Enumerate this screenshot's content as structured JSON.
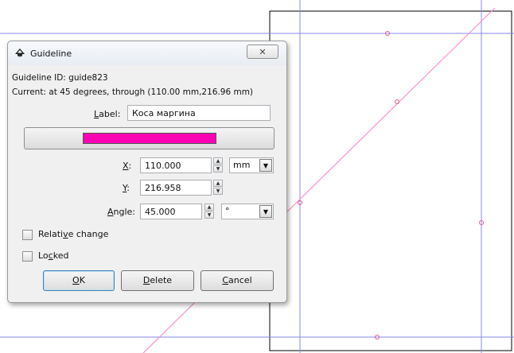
{
  "window": {
    "title": "Guideline",
    "close_symbol": "✕"
  },
  "info": {
    "guide_id": "Guideline ID: guide823",
    "current": "Current: at 45 degrees, through (110.00 mm,216.96 mm)"
  },
  "fields": {
    "label": {
      "prefix": "",
      "accel": "L",
      "rest": "abel:",
      "value": "Коса маргина"
    },
    "color": "#ff00b4",
    "x": {
      "accel": "X",
      "rest": ":",
      "value": "110.000"
    },
    "y": {
      "accel": "Y",
      "rest": ":",
      "value": "216.958"
    },
    "angle": {
      "prefix": "",
      "accel": "A",
      "rest": "ngle:",
      "value": "45.000"
    },
    "unit": "mm",
    "angle_unit": "°"
  },
  "checkboxes": {
    "relative": {
      "prefix": "Relati",
      "accel": "v",
      "rest": "e change",
      "checked": false
    },
    "locked": {
      "prefix": "Lo",
      "accel": "c",
      "rest": "ked",
      "checked": false
    }
  },
  "buttons": {
    "ok": {
      "prefix": "",
      "accel": "O",
      "rest": "K"
    },
    "delete": {
      "prefix": "",
      "accel": "D",
      "rest": "elete"
    },
    "cancel": {
      "prefix": "",
      "accel": "C",
      "rest": "ancel"
    }
  },
  "colors": {
    "guide": "#8080ff",
    "guide_selected": "#ff80c0",
    "page_border": "#000000"
  }
}
